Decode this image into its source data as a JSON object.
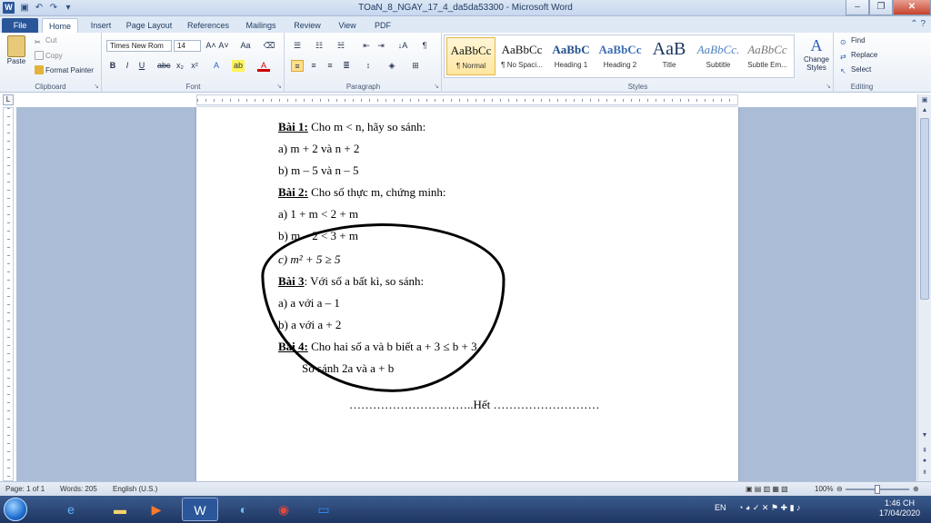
{
  "window": {
    "title": "TOaN_8_NGAY_17_4_da5da53300 - Microsoft Word",
    "app_letter": "W",
    "qa_icons": [
      "save-icon",
      "undo-icon",
      "redo-icon",
      "customize-icon"
    ]
  },
  "tabs": [
    {
      "label": "File"
    },
    {
      "label": "Home"
    },
    {
      "label": "Insert"
    },
    {
      "label": "Page Layout"
    },
    {
      "label": "References"
    },
    {
      "label": "Mailings"
    },
    {
      "label": "Review"
    },
    {
      "label": "View"
    },
    {
      "label": "PDF"
    }
  ],
  "ribbon": {
    "clipboard": {
      "label": "Clipboard",
      "paste": "Paste",
      "cut": "Cut",
      "copy": "Copy",
      "format_painter": "Format Painter"
    },
    "font": {
      "label": "Font",
      "name": "Times New Rom",
      "size": "14"
    },
    "paragraph": {
      "label": "Paragraph"
    },
    "styles": {
      "label": "Styles",
      "items": [
        {
          "sample": "AaBbCc",
          "name": "¶ Normal"
        },
        {
          "sample": "AaBbCc",
          "name": "¶ No Spaci..."
        },
        {
          "sample": "AaBbC",
          "name": "Heading 1"
        },
        {
          "sample": "AaBbCc",
          "name": "Heading 2"
        },
        {
          "sample": "AaB",
          "name": "Title"
        },
        {
          "sample": "AaBbCc.",
          "name": "Subtitle"
        },
        {
          "sample": "AaBbCc",
          "name": "Subtle Em..."
        }
      ],
      "change_styles": "Change Styles"
    },
    "editing": {
      "label": "Editing",
      "find": "Find",
      "replace": "Replace",
      "select": "Select"
    }
  },
  "document": {
    "lines": [
      {
        "bold": "Bài 1:",
        "text": "  Cho m < n, hãy so sánh:"
      },
      {
        "bold": "",
        "text": "a) m + 2 và n + 2"
      },
      {
        "bold": "",
        "text": "b) m – 5 và n – 5"
      },
      {
        "bold": "Bài 2:",
        "text": " Cho số thực m, chứng minh:"
      },
      {
        "bold": "",
        "text": "a) 1 + m < 2 + m"
      },
      {
        "bold": "",
        "text": "b) m – 2 < 3 + m"
      },
      {
        "bold": "",
        "text": "c)  m² + 5 ≥ 5"
      },
      {
        "bold": "Bài 3",
        "text": ": Với số a bất kì, so sánh:"
      },
      {
        "bold": "",
        "text": "a) a với a – 1"
      },
      {
        "bold": "",
        "text": "b) a với a + 2"
      },
      {
        "bold": "Bài 4:",
        "text": " Cho hai số a và b biết a + 3  ≤  b + 3"
      },
      {
        "bold": "",
        "text": "        So sánh 2a và a + b"
      }
    ],
    "footer_line": "…………………………..Hết ………………………"
  },
  "status": {
    "page": "Page: 1 of 1",
    "words": "Words: 205",
    "language": "English (U.S.)",
    "zoom": "100%",
    "zoom_level": 1.0
  },
  "taskbar": {
    "lang": "EN",
    "time": "1:46 CH",
    "date": "17/04/2020"
  }
}
